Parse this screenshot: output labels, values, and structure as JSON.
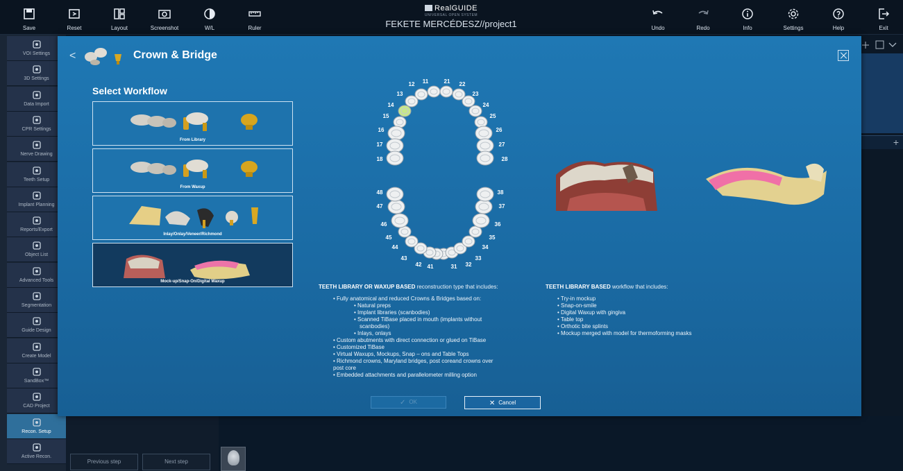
{
  "toolbar": {
    "save": "Save",
    "reset": "Reset",
    "layout": "Layout",
    "screenshot": "Screenshot",
    "wl": "W/L",
    "ruler": "Ruler",
    "undo": "Undo",
    "redo": "Redo",
    "info": "Info",
    "settings": "Settings",
    "help": "Help",
    "exit": "Exit"
  },
  "brand": {
    "name": "RealGUIDE",
    "tagline": "UNIVERSAL OPEN SYSTEM",
    "project": "FEKETE MERCÉDESZ//project1"
  },
  "sidebar": {
    "items": [
      {
        "label": "VOI Settings",
        "icon": "cube-icon"
      },
      {
        "label": "3D Settings",
        "icon": "3d-rotate-icon"
      },
      {
        "label": "Data Import",
        "icon": "import-icon"
      },
      {
        "label": "CPR Settings",
        "icon": "arch-curve-icon"
      },
      {
        "label": "Nerve Drawing",
        "icon": "nerve-icon"
      },
      {
        "label": "Teeth Setup",
        "icon": "tooth-icon"
      },
      {
        "label": "Implant Planning",
        "icon": "implant-icon"
      },
      {
        "label": "Reports/Export",
        "icon": "report-icon"
      },
      {
        "label": "Object List",
        "icon": "list-icon"
      },
      {
        "label": "Advanced Tools",
        "icon": "head-gear-icon"
      },
      {
        "label": "Segmentation",
        "icon": "segmentation-icon"
      },
      {
        "label": "Guide Design",
        "icon": "guide-icon"
      },
      {
        "label": "Create Model",
        "icon": "model-icon"
      },
      {
        "label": "SandBox™",
        "icon": "sandbox-icon"
      },
      {
        "label": "CAD Project",
        "icon": "cad-icon"
      },
      {
        "label": "Recon. Setup",
        "icon": "recon-setup-icon"
      },
      {
        "label": "Active Recon.",
        "icon": "active-recon-icon"
      }
    ],
    "active_index": 15
  },
  "steps": {
    "previous": "Previous step",
    "next": "Next step"
  },
  "dialog": {
    "title": "Crown & Bridge",
    "back": "<",
    "workflow_heading": "Select Workflow",
    "workflows": [
      {
        "label": "From Library"
      },
      {
        "label": "From Waxup"
      },
      {
        "label": "Inlay/Onlay/Veneer/Richmond"
      },
      {
        "label": "Mock-up/Snap-On/Digital Waxup"
      }
    ],
    "selected_workflow": 3,
    "teeth": {
      "upper": [
        "11",
        "12",
        "13",
        "14",
        "15",
        "16",
        "17",
        "18",
        "21",
        "22",
        "23",
        "24",
        "25",
        "26",
        "27",
        "28"
      ],
      "lower": [
        "31",
        "32",
        "33",
        "34",
        "35",
        "36",
        "37",
        "38",
        "41",
        "42",
        "43",
        "44",
        "45",
        "46",
        "47",
        "48"
      ],
      "highlighted": "14",
      "highlight_color": "#c7e88a"
    },
    "left_desc": {
      "head_bold": "TEETH LIBRARY OR WAXUP BASED",
      "head_rest": " reconstruction type that includes:",
      "lines": [
        {
          "level": 1,
          "text": "• Fully anatomical and reduced Crowns & Bridges based on:"
        },
        {
          "level": 2,
          "text": "• Natural preps"
        },
        {
          "level": 2,
          "text": "• Implant libraries (scanbodies)"
        },
        {
          "level": 2,
          "text": "• Scanned TiBase placed in mouth (implants without"
        },
        {
          "level": 3,
          "text": "scanbodies)"
        },
        {
          "level": 2,
          "text": "• Inlays, onlays"
        },
        {
          "level": 1,
          "text": "• Custom abutments with direct connection or glued on TiBase"
        },
        {
          "level": 1,
          "text": "• Customized TiBase"
        },
        {
          "level": 1,
          "text": "• Virtual Waxups, Mockups, Snap – ons and Table Tops"
        },
        {
          "level": 1,
          "text": "• Richmond crowns, Maryland bridges, post coreand crowns over"
        },
        {
          "level": 1,
          "text": "post core"
        },
        {
          "level": 1,
          "text": "• Embedded attachments and parallelometer milling option"
        }
      ]
    },
    "right_desc": {
      "head_bold": "TEETH LIBRARY BASED",
      "head_rest": " workflow that includes:",
      "lines": [
        "• Try-in mockup",
        "• Snap-on-smile",
        "• Digital Waxup with gingiva",
        "• Table top",
        "• Orthotic bite splints",
        "• Mockup merged with model for thermoforming masks"
      ]
    },
    "ok_label": "OK",
    "cancel_label": "Cancel"
  },
  "colors": {
    "dialog_bg": "#1f78b4",
    "toolbar_bg": "#0a1420",
    "sidebar_active": "#2f6f9b",
    "tooth_highlight": "#c7e88a"
  }
}
